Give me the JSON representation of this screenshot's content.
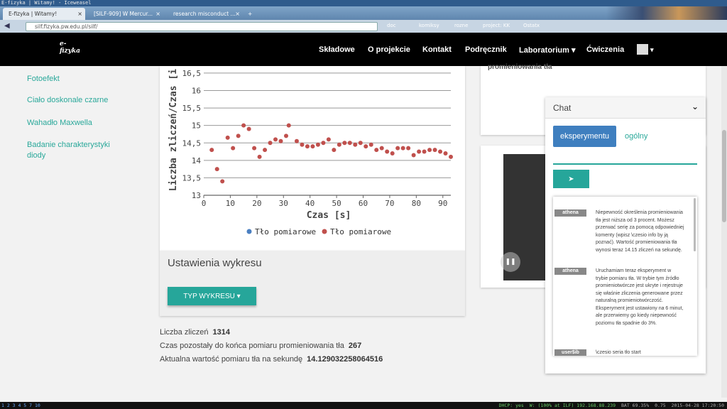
{
  "window": {
    "title": "E-fizyka | Witamy! - Iceweasel"
  },
  "tabs": [
    {
      "label": "E-fizyka | Witamy!"
    },
    {
      "label": "[SILF-909] W Mercur..."
    },
    {
      "label": "research misconduct ..."
    }
  ],
  "browser": {
    "url": "silf.fizyka.pw.edu.pl/silf/",
    "bookmarks": [
      "doc",
      "komiksy",
      "rozne",
      "project: KK",
      "Ostatx"
    ]
  },
  "nav": {
    "logo": "e-fizyka",
    "items": [
      "Składowe",
      "O projekcie",
      "Kontakt",
      "Podręcznik",
      "Laboratorium ▾",
      "Ćwiczenia"
    ],
    "user_caret": "▾"
  },
  "sidebar": {
    "items": [
      "Fotoefekt",
      "Ciało doskonale czarne",
      "Wahadło Maxwella",
      "Badanie charakterystyki diody"
    ]
  },
  "chart_data": {
    "type": "scatter",
    "xlabel": "Czas [s]",
    "ylabel": "Liczba zliczeń/Czas [i",
    "xlim": [
      0,
      93
    ],
    "ylim": [
      13,
      16.6
    ],
    "xticks": [
      0,
      10,
      20,
      30,
      40,
      50,
      60,
      70,
      80,
      90
    ],
    "yticks": [
      13,
      13.5,
      14,
      14.5,
      15,
      15.5,
      16,
      16.5
    ],
    "grid": true,
    "legend_position": "bottom",
    "series": [
      {
        "name": "Tło pomiarowe",
        "color": "#4a7fc1",
        "x": [],
        "y": []
      },
      {
        "name": "Tło pomiarowe",
        "color": "#c0504d",
        "x": [
          3,
          5,
          7,
          9,
          11,
          13,
          15,
          17,
          19,
          21,
          23,
          25,
          27,
          29,
          31,
          32,
          35,
          37,
          39,
          41,
          43,
          45,
          47,
          49,
          51,
          53,
          55,
          57,
          59,
          61,
          63,
          65,
          67,
          69,
          71,
          73,
          75,
          77,
          79,
          81,
          83,
          85,
          87,
          89,
          91,
          93
        ],
        "y": [
          14.3,
          13.75,
          13.4,
          14.65,
          14.35,
          14.7,
          15.0,
          14.9,
          14.35,
          14.1,
          14.3,
          14.5,
          14.6,
          14.55,
          14.7,
          15.0,
          14.55,
          14.45,
          14.4,
          14.4,
          14.45,
          14.5,
          14.6,
          14.3,
          14.45,
          14.5,
          14.5,
          14.45,
          14.5,
          14.4,
          14.45,
          14.3,
          14.35,
          14.25,
          14.2,
          14.35,
          14.35,
          14.35,
          14.15,
          14.25,
          14.25,
          14.3,
          14.3,
          14.25,
          14.2,
          14.1
        ]
      }
    ]
  },
  "settings": {
    "title": "Ustawienia wykresu",
    "type_button": "TYP WYKRESU ▾"
  },
  "stats": [
    {
      "label": "Liczba zliczeń",
      "value": "1314"
    },
    {
      "label": "Czas pozostały do końca pomiaru promieniowania tła",
      "value": "267"
    },
    {
      "label": "Aktualna wartość pomiaru tła na sekundę",
      "value": "14.129032258064516"
    }
  ],
  "right_card": {
    "text": "promieniowania tła"
  },
  "chat": {
    "title": "Chat",
    "tabs": [
      "eksperymentu",
      "ogólny"
    ],
    "send_icon": "➤",
    "messages": [
      {
        "user": "athena",
        "text": "Niepewność określenia promieniowania tła jest niższa od 3 procent. Możesz przerwać serię za pomocą odpowiedniej komenty (wpisz \\czesio info by ją poznać). Wartość promieniowania tła wynosi teraz 14.15 zliczeń na sekundę."
      },
      {
        "user": "athena",
        "text": "Uruchamiam teraz eksperyment w trybie pomiaru tła. W trybie tym źródło promieniotwórcze jest ukryte i rejestruje się właśnie zliczenia generowane przez naturalną promieniotwórczość. Eksperyment jest ustawiony na 6 minut, ale przerwiemy go kiedy niepewność poziomu tła spadnie do 3%."
      },
      {
        "user": "user$ib",
        "text": "\\czesio seria tło start"
      }
    ]
  },
  "statusbar": {
    "workspaces": "1 2 3 4 5 7 10",
    "items": [
      "DHCP: yes",
      "W: (100% at ILF) 192.168.88.239",
      "BAT 69.35%",
      "0.75",
      "2015-04-28 17:20:50"
    ]
  },
  "colors": {
    "accent": "#26a69a",
    "tab_active": "#3f7fbf",
    "point_red": "#c0504d",
    "point_blue": "#4a7fc1"
  }
}
